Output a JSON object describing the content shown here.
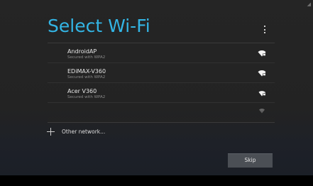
{
  "header": {
    "title": "Select Wi-Fi",
    "overflow_icon": "vertical-dots-icon",
    "corner_icon": "wifi-status-icon"
  },
  "networks": [
    {
      "name": "AndroidAP",
      "status": "Secured with WPA2",
      "icon": "wifi-signal-locked-icon"
    },
    {
      "name": "EDiMAX-V360",
      "status": "Secured with WPA2",
      "icon": "wifi-signal-locked-icon"
    },
    {
      "name": "Acer V360",
      "status": "Secured with WPA2",
      "icon": "wifi-signal-locked-icon"
    },
    {
      "name": "",
      "status": "",
      "icon": "wifi-signal-locked-icon"
    }
  ],
  "other_network": {
    "label": "Other network...",
    "icon": "plus-icon"
  },
  "footer": {
    "skip_label": "Skip"
  },
  "colors": {
    "accent": "#33b5e5",
    "background": "#232323",
    "button": "#4b4f55"
  }
}
